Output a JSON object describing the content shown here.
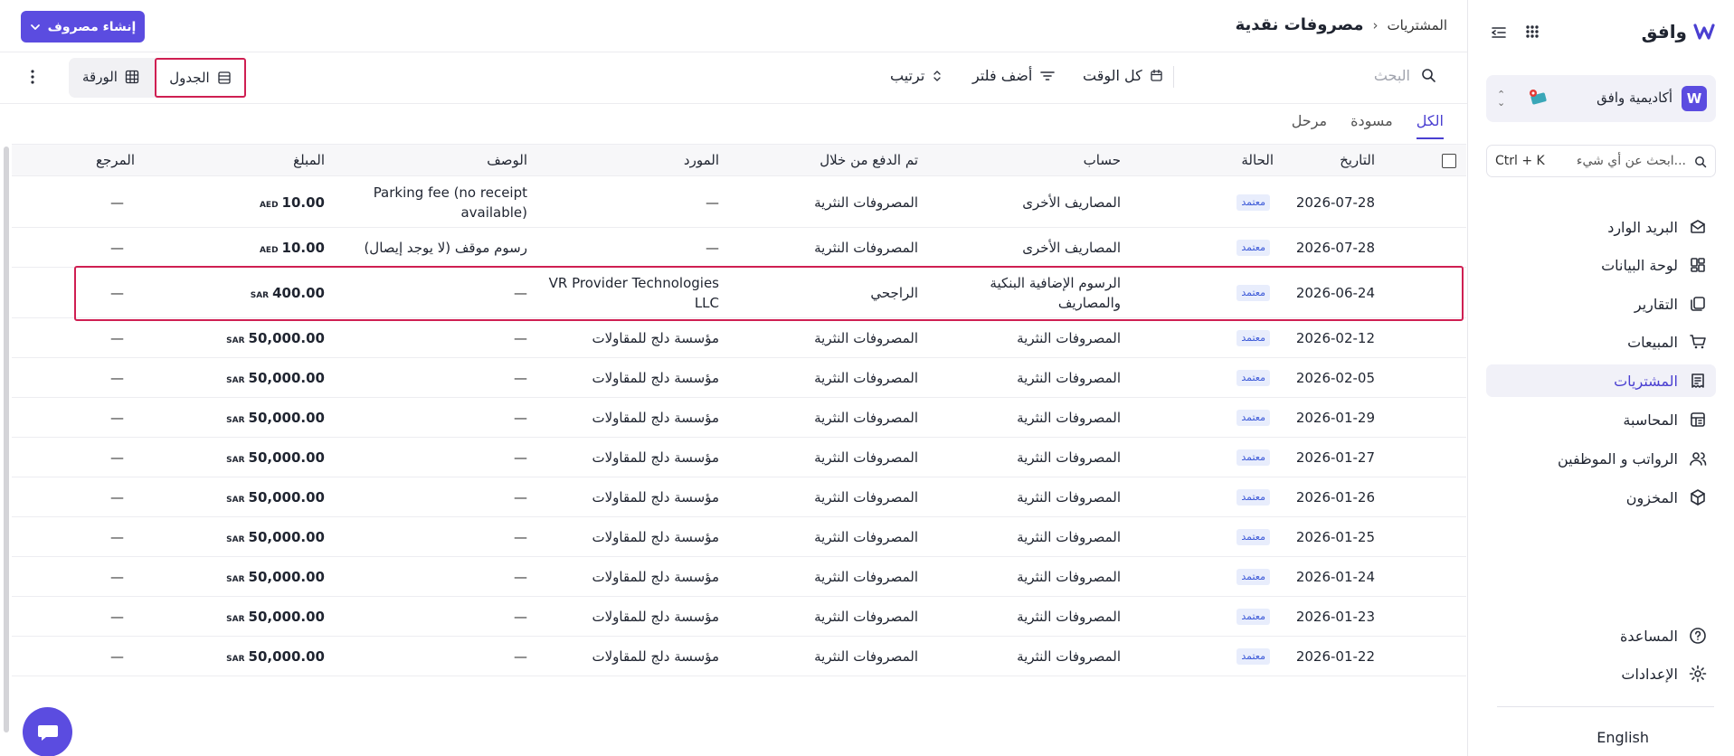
{
  "app": {
    "brand": "وافق"
  },
  "sidebar": {
    "org_name": "أكاديمية وافق",
    "org_badge": "W",
    "search_placeholder": "ابحث عن أي شيء...",
    "search_shortcut": "Ctrl + K",
    "items": [
      {
        "label": "البريد الوارد",
        "icon": "inbox-icon"
      },
      {
        "label": "لوحة البيانات",
        "icon": "dashboard-icon"
      },
      {
        "label": "التقارير",
        "icon": "reports-icon"
      },
      {
        "label": "المبيعات",
        "icon": "cart-icon"
      },
      {
        "label": "المشتريات",
        "icon": "purchases-icon",
        "active": true
      },
      {
        "label": "المحاسبة",
        "icon": "accounting-icon"
      },
      {
        "label": "الرواتب و الموظفين",
        "icon": "people-icon"
      },
      {
        "label": "المخزون",
        "icon": "box-icon"
      }
    ],
    "bottom": [
      {
        "label": "المساعدة",
        "icon": "help-icon"
      },
      {
        "label": "الإعدادات",
        "icon": "settings-icon"
      }
    ],
    "language": "English"
  },
  "header": {
    "breadcrumb_parent": "المشتريات",
    "breadcrumb_sep": "›",
    "title": "مصروفات نقدية",
    "create_button": "إنشاء مصروف"
  },
  "toolbar": {
    "search_placeholder": "البحث",
    "time_filter": "كل الوقت",
    "add_filter": "أضف فلتر",
    "sort": "ترتيب",
    "view_table": "الجدول",
    "view_sheet": "الورقة"
  },
  "tabs": [
    {
      "label": "الكل",
      "active": true
    },
    {
      "label": "مسودة"
    },
    {
      "label": "مرحل"
    }
  ],
  "table": {
    "columns": {
      "date": "التاريخ",
      "status": "الحالة",
      "account": "حساب",
      "paid_through": "تم الدفع من خلال",
      "vendor": "المورد",
      "description": "الوصف",
      "amount": "المبلغ",
      "reference": "المرجع"
    },
    "rows": [
      {
        "date": "2026-07-28",
        "status": "معتمد",
        "account": "المصاريف الأخرى",
        "paid_through": "المصروفات النثرية",
        "vendor": "—",
        "description": "Parking fee (no receipt available)",
        "amount": "10.00",
        "currency": "AED",
        "reference": "—"
      },
      {
        "date": "2026-07-28",
        "status": "معتمد",
        "account": "المصاريف الأخرى",
        "paid_through": "المصروفات النثرية",
        "vendor": "—",
        "description": "رسوم موقف (لا يوجد إيصال)",
        "amount": "10.00",
        "currency": "AED",
        "reference": "—"
      },
      {
        "date": "2026-06-24",
        "status": "معتمد",
        "account": "الرسوم الإضافية البنكية والمصاريف",
        "paid_through": "الراجحي",
        "vendor": "VR Provider Technologies LLC",
        "description": "—",
        "amount": "400.00",
        "currency": "SAR",
        "reference": "—"
      },
      {
        "date": "2026-02-12",
        "status": "معتمد",
        "account": "المصروفات النثرية",
        "paid_through": "المصروفات النثرية",
        "vendor": "مؤسسة دلج للمقاولات",
        "description": "—",
        "amount": "50,000.00",
        "currency": "SAR",
        "reference": "—"
      },
      {
        "date": "2026-02-05",
        "status": "معتمد",
        "account": "المصروفات النثرية",
        "paid_through": "المصروفات النثرية",
        "vendor": "مؤسسة دلج للمقاولات",
        "description": "—",
        "amount": "50,000.00",
        "currency": "SAR",
        "reference": "—"
      },
      {
        "date": "2026-01-29",
        "status": "معتمد",
        "account": "المصروفات النثرية",
        "paid_through": "المصروفات النثرية",
        "vendor": "مؤسسة دلج للمقاولات",
        "description": "—",
        "amount": "50,000.00",
        "currency": "SAR",
        "reference": "—"
      },
      {
        "date": "2026-01-27",
        "status": "معتمد",
        "account": "المصروفات النثرية",
        "paid_through": "المصروفات النثرية",
        "vendor": "مؤسسة دلج للمقاولات",
        "description": "—",
        "amount": "50,000.00",
        "currency": "SAR",
        "reference": "—"
      },
      {
        "date": "2026-01-26",
        "status": "معتمد",
        "account": "المصروفات النثرية",
        "paid_through": "المصروفات النثرية",
        "vendor": "مؤسسة دلج للمقاولات",
        "description": "—",
        "amount": "50,000.00",
        "currency": "SAR",
        "reference": "—"
      },
      {
        "date": "2026-01-25",
        "status": "معتمد",
        "account": "المصروفات النثرية",
        "paid_through": "المصروفات النثرية",
        "vendor": "مؤسسة دلج للمقاولات",
        "description": "—",
        "amount": "50,000.00",
        "currency": "SAR",
        "reference": "—"
      },
      {
        "date": "2026-01-24",
        "status": "معتمد",
        "account": "المصروفات النثرية",
        "paid_through": "المصروفات النثرية",
        "vendor": "مؤسسة دلج للمقاولات",
        "description": "—",
        "amount": "50,000.00",
        "currency": "SAR",
        "reference": "—"
      },
      {
        "date": "2026-01-23",
        "status": "معتمد",
        "account": "المصروفات النثرية",
        "paid_through": "المصروفات النثرية",
        "vendor": "مؤسسة دلج للمقاولات",
        "description": "—",
        "amount": "50,000.00",
        "currency": "SAR",
        "reference": "—"
      },
      {
        "date": "2026-01-22",
        "status": "معتمد",
        "account": "المصروفات النثرية",
        "paid_through": "المصروفات النثرية",
        "vendor": "مؤسسة دلج للمقاولات",
        "description": "—",
        "amount": "50,000.00",
        "currency": "SAR",
        "reference": "—"
      }
    ]
  },
  "colors": {
    "accent": "#5b4ce0",
    "highlight": "#cf1f52",
    "badge_bg": "#e8edfc",
    "badge_text": "#3d5ad8"
  }
}
